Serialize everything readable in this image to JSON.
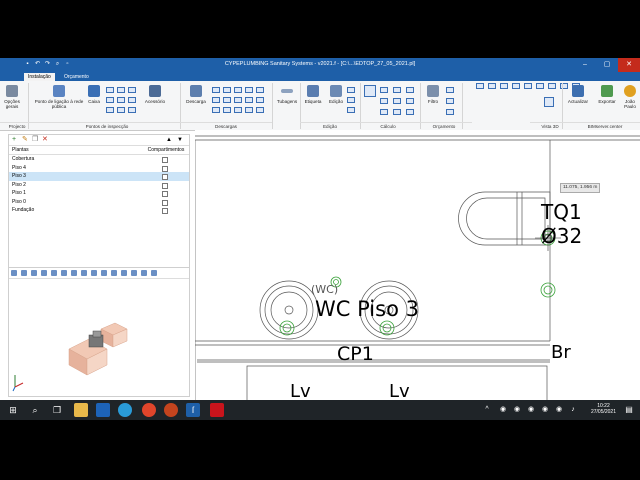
{
  "window": {
    "title": "CYPEPLUMBING Sanitary Systems - v2021.f - [C:\\...\\EDTOP_27_05_2021.pl]",
    "logo_letter": "ſ"
  },
  "tabs": [
    "Instalação",
    "Orçamento"
  ],
  "ribbon": {
    "buttons": [
      {
        "label": "Opções gerais"
      },
      {
        "label": "Ponto de ligação à rede pública"
      },
      {
        "label": "Caixa"
      },
      {
        "label": "Acessório"
      },
      {
        "label": "Descarga"
      },
      {
        "label": "Tubagens"
      },
      {
        "label": "Etiqueta"
      },
      {
        "label": "Edição"
      },
      {
        "label": "Filtro"
      },
      {
        "label": "Actualizar"
      },
      {
        "label": "Exportar"
      },
      {
        "label": "João Paulo"
      }
    ],
    "groups": [
      "Projecto",
      "Pontos de inspecção",
      "Descargas",
      "Edição",
      "Cálculo",
      "Orçamento",
      "Vista 3D",
      "BIMserver.center"
    ]
  },
  "floors_panel": {
    "col_plantas": "Plantas",
    "col_comp": "Compartimentos",
    "floors": [
      "Cobertura",
      "Piso 4",
      "Piso 3",
      "Piso 2",
      "Piso 1",
      "Piso 0",
      "Fundação"
    ],
    "selected_index": 2
  },
  "canvas": {
    "tq_label": "TQ1",
    "diameter": "Ø32",
    "coord_tooltip": "11.075, 1.956 m",
    "room_type": "(WC)",
    "room_name": "WC Piso 3",
    "cp_label": "CP1",
    "br_label": "Br",
    "lv_label_1": "Lv",
    "lv_label_2": "Lv"
  },
  "taskbar": {
    "time": "10:22",
    "date": "27/05/2021"
  },
  "colors": {
    "title_blue": "#1e5fa8",
    "selection": "#cce4f7",
    "fixture_green": "#3aa13a",
    "taskbar": "#1f2428"
  }
}
